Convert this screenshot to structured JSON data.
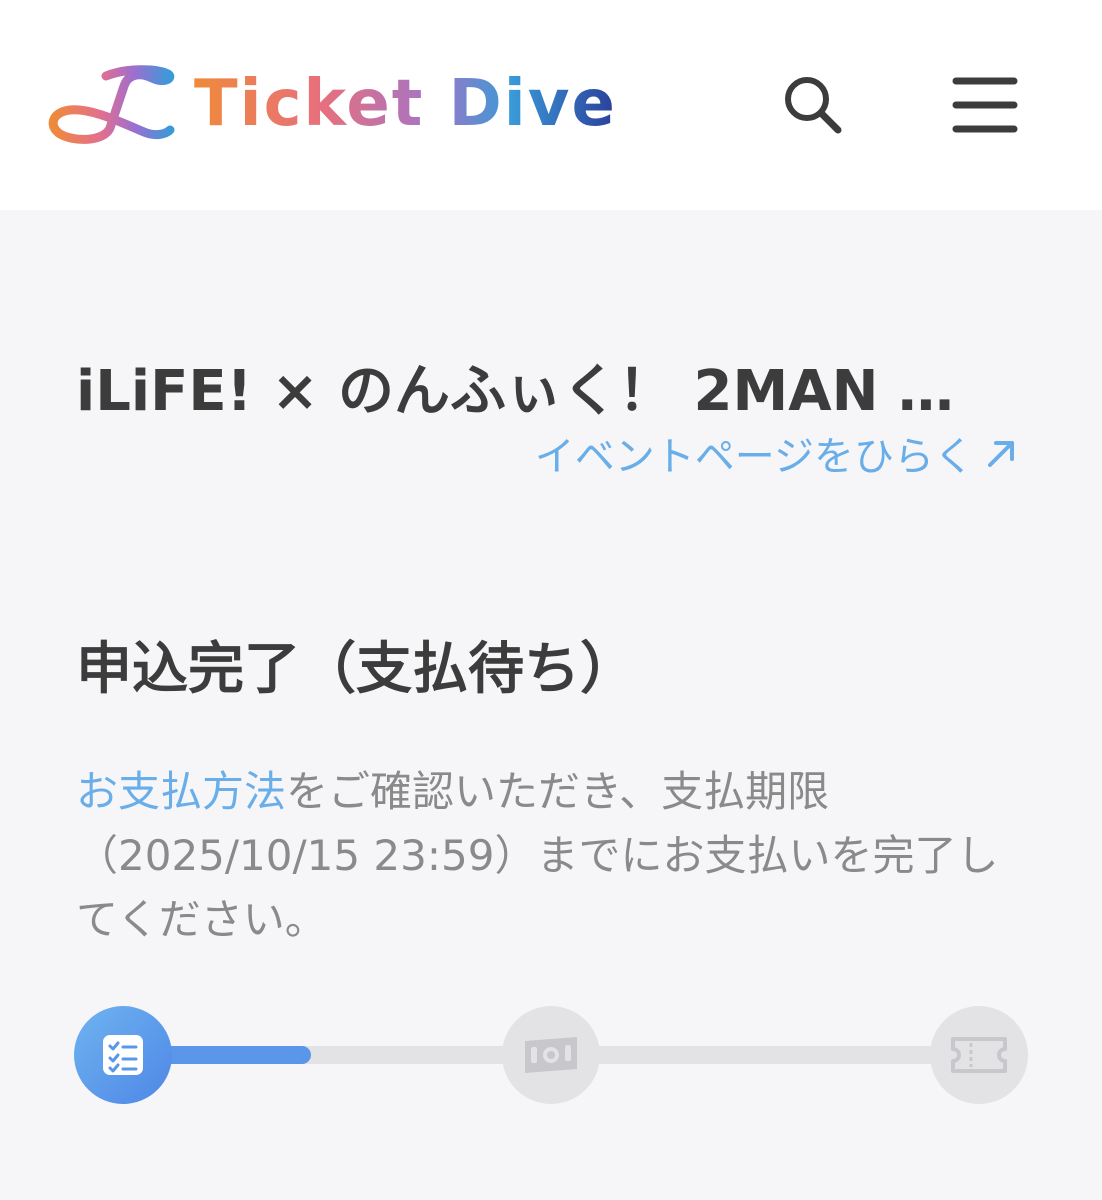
{
  "header": {
    "logo_text": "Ticket Dive",
    "search_icon": "search-icon",
    "menu_icon": "hamburger-menu-icon"
  },
  "event": {
    "title": "iLiFE! × のんふぃく！ 2MAN …",
    "open_link_label": "イベントページをひらく",
    "open_link_icon": "arrow-up-right-icon"
  },
  "status": {
    "heading": "申込完了（支払待ち）"
  },
  "instructions": {
    "payment_link": "お支払方法",
    "text_after_link": "をご確認いただき、支払期限（2025/10/15 23:59）までにお支払いを完了してください。"
  },
  "progress": {
    "steps": [
      {
        "icon": "checklist-icon",
        "state": "active"
      },
      {
        "icon": "banknote-icon",
        "state": "inactive"
      },
      {
        "icon": "ticket-icon",
        "state": "inactive"
      }
    ],
    "fill_fraction": 0.22,
    "colors": {
      "active": "#5a97ea",
      "inactive": "#e3e3e6"
    }
  },
  "colors": {
    "link": "#6aaee9",
    "background": "#f6f6f9",
    "header_background": "#ffffff",
    "heading_text": "#3c3c3c",
    "body_text": "#8a8a8a"
  }
}
